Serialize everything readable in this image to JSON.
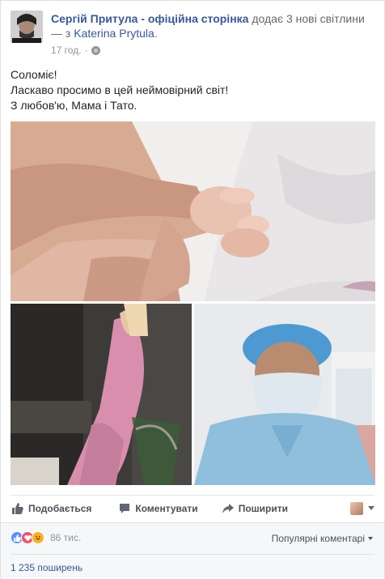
{
  "post": {
    "author": "Сергій Притула - офіційна сторінка",
    "added_text": " додає 3 нові світлини — з ",
    "with_user": "Katerina Prytula",
    "tail": ".",
    "timestamp": "17 год.",
    "separator": "·",
    "privacy_icon": "globe-icon",
    "message_lines": [
      "Соломіє!",
      "Ласкаво просимо в цей неймовірний світ!",
      "З любов'ю, Мама і Тато."
    ]
  },
  "actions": {
    "like_label": "Подобається",
    "comment_label": "Коментувати",
    "share_label": "Поширити"
  },
  "stats": {
    "reaction_count": "86 тис.",
    "sort_label": "Популярні коментарі",
    "shares": "1 235 поширень"
  },
  "colors": {
    "link": "#365899",
    "like_blue": "#5890ff",
    "love_red": "#f25268",
    "haha_yellow": "#f7b125"
  }
}
